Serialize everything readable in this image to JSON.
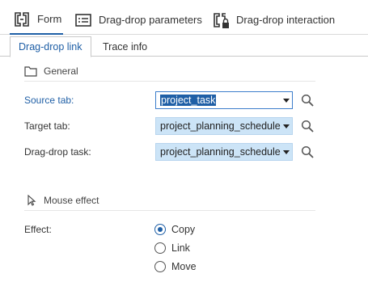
{
  "top_tabs": [
    {
      "label": "Form",
      "active": true,
      "icon": "form-icon"
    },
    {
      "label": "Drag-drop parameters",
      "active": false,
      "icon": "parameters-list-icon"
    },
    {
      "label": "Drag-drop interaction",
      "active": false,
      "icon": "locked-interaction-icon"
    }
  ],
  "sub_tabs": [
    {
      "label": "Drag-drop link",
      "active": true
    },
    {
      "label": "Trace info",
      "active": false
    }
  ],
  "general": {
    "title": "General",
    "source_tab": {
      "label": "Source tab:",
      "value": "project_task"
    },
    "target_tab": {
      "label": "Target tab:",
      "value": "project_planning_schedule"
    },
    "drag_drop_task": {
      "label": "Drag-drop task:",
      "value": "project_planning_schedule"
    }
  },
  "mouse_effect": {
    "title": "Mouse effect",
    "effect_label": "Effect:",
    "options": [
      {
        "label": "Copy",
        "checked": true
      },
      {
        "label": "Link",
        "checked": false
      },
      {
        "label": "Move",
        "checked": false
      }
    ]
  },
  "colors": {
    "accent": "#1f5fa6",
    "select_bg": "#cce4f7"
  }
}
